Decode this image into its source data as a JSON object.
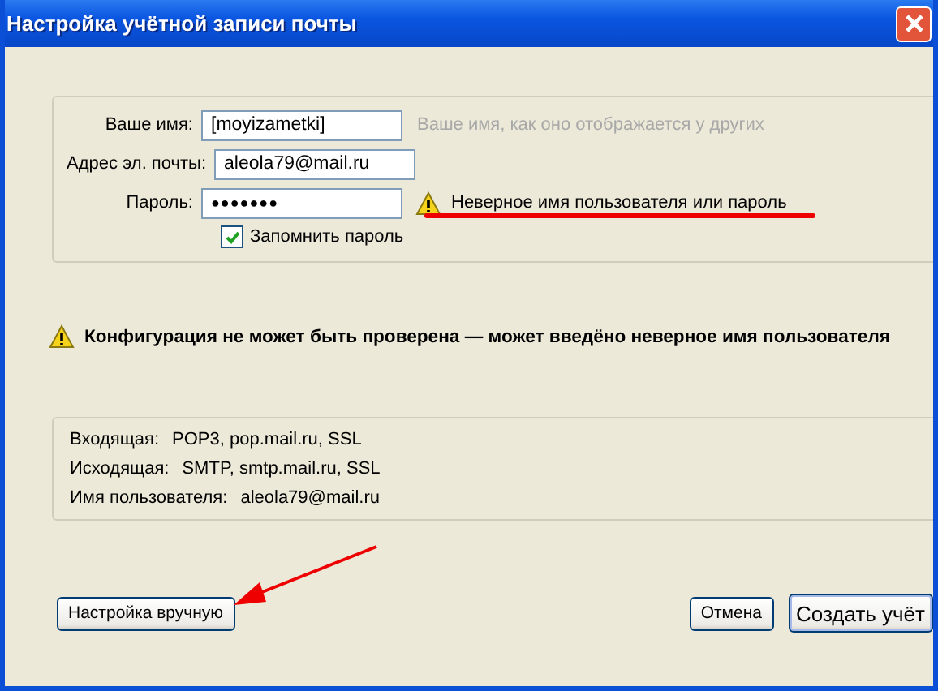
{
  "window": {
    "title": "Настройка учётной записи почты"
  },
  "fields": [
    {
      "label": "Ваше имя:",
      "value": "[moyizametki]",
      "hint": "Ваше имя, как оно отображается у других"
    },
    {
      "label": "Адрес эл. почты:",
      "value": "aleola79@mail.ru"
    },
    {
      "label": "Пароль:",
      "value": "●●●●●●●",
      "error": "Неверное имя пользователя или пароль"
    }
  ],
  "remember": {
    "label": "Запомнить пароль",
    "checked": true
  },
  "warning": "Конфигурация не может быть проверена — может введёно неверное имя пользователя",
  "summary": [
    {
      "label": "Входящая:",
      "value": "POP3, pop.mail.ru, SSL"
    },
    {
      "label": "Исходящая:",
      "value": "SMTP, smtp.mail.ru, SSL"
    },
    {
      "label": "Имя пользователя:",
      "value": "aleola79@mail.ru"
    }
  ],
  "buttons": {
    "manual": "Настройка вручную",
    "cancel": "Отмена",
    "create": "Создать учёт"
  }
}
